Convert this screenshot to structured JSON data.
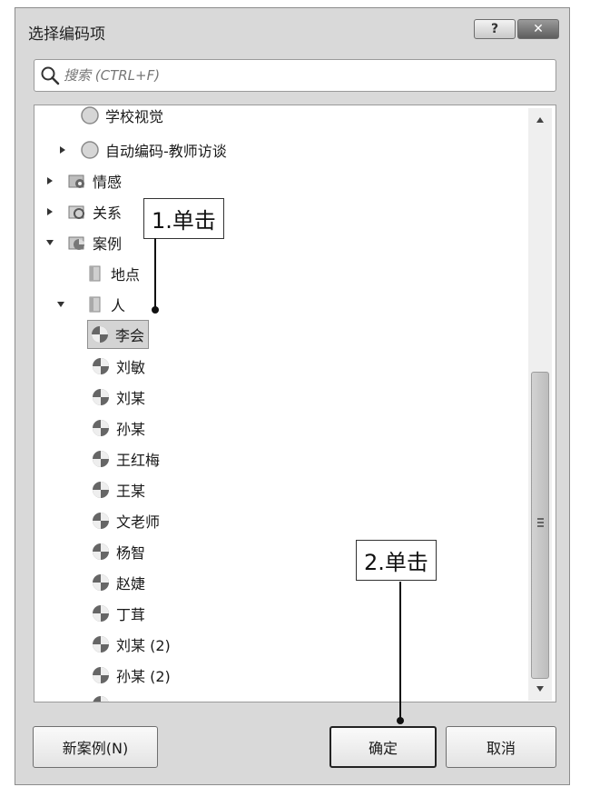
{
  "dialog": {
    "title": "选择编码项",
    "help_label": "?",
    "close_label": "✕"
  },
  "search": {
    "placeholder": "搜索 (CTRL+F)"
  },
  "tree": {
    "items": [
      {
        "label": "学校视觉"
      },
      {
        "label": "自动编码-教师访谈"
      },
      {
        "label": "情感"
      },
      {
        "label": "关系"
      },
      {
        "label": "案例"
      },
      {
        "label": "地点"
      },
      {
        "label": "人"
      },
      {
        "label": "李会",
        "selected": true
      },
      {
        "label": "刘敏"
      },
      {
        "label": "刘某"
      },
      {
        "label": "孙某"
      },
      {
        "label": "王红梅"
      },
      {
        "label": "王某"
      },
      {
        "label": "文老师"
      },
      {
        "label": "杨智"
      },
      {
        "label": "赵婕"
      },
      {
        "label": "丁茸"
      },
      {
        "label": "刘某 (2)"
      },
      {
        "label": "孙某 (2)"
      }
    ]
  },
  "buttons": {
    "new_case": "新案例(N)",
    "ok": "确定",
    "cancel": "取消"
  },
  "annotations": {
    "step1": "1.单击",
    "step2": "2.单击"
  },
  "colors": {
    "dialog_bg": "#d9d9d9",
    "selection": "#d4d4d4"
  }
}
